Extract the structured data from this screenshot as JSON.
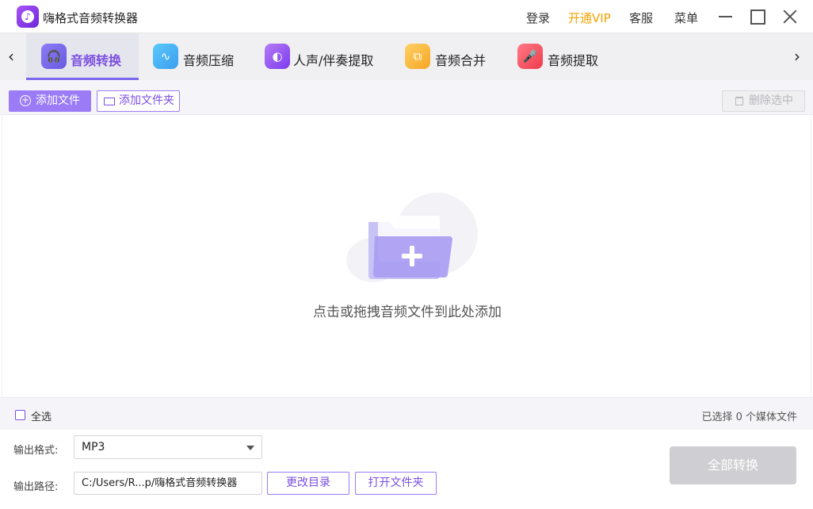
{
  "app": {
    "title": "嗨格式音频转换器"
  },
  "titlebar": {
    "login": "登录",
    "vip": "开通VIP",
    "service": "客服",
    "menu": "菜单"
  },
  "tabs": [
    {
      "label": "音频转换",
      "icon": "headphones-icon",
      "active": true
    },
    {
      "label": "音频压缩",
      "icon": "waveform-icon",
      "active": false
    },
    {
      "label": "人声/伴奏提取",
      "icon": "voice-icon",
      "active": false
    },
    {
      "label": "音频合并",
      "icon": "merge-icon",
      "active": false
    },
    {
      "label": "音频提取",
      "icon": "microphone-icon",
      "active": false
    }
  ],
  "toolbar": {
    "add_file": "添加文件",
    "add_folder": "添加文件夹",
    "delete_selected": "删除选中"
  },
  "dropzone": {
    "hint": "点击或拖拽音频文件到此处添加"
  },
  "status": {
    "select_all": "全选",
    "selected_count": "已选择 0 个媒体文件"
  },
  "output": {
    "format_label": "输出格式:",
    "format_value": "MP3",
    "path_label": "输出路径:",
    "path_value": "C:/Users/R...p/嗨格式音频转换器",
    "change_dir": "更改目录",
    "open_folder": "打开文件夹"
  },
  "convert_all": "全部转换",
  "colors": {
    "accent": "#9b7cf6",
    "vip": "#f5a200",
    "disabled": "#cfcfd3"
  }
}
